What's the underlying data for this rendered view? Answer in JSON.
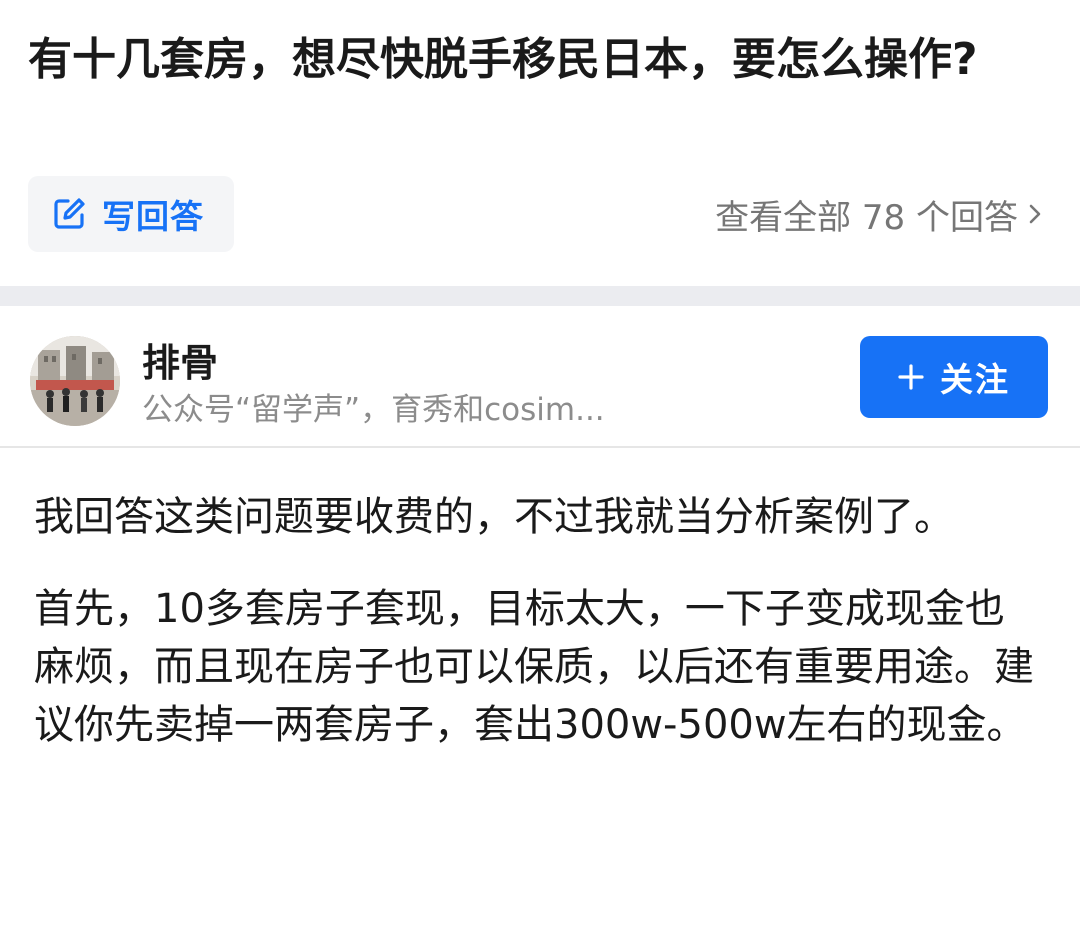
{
  "question": {
    "title": "有十几套房，想尽快脱手移民日本，要怎么操作?",
    "write_answer_label": "写回答",
    "view_all_label": "查看全部 78 个回答"
  },
  "answer": {
    "author": {
      "name": "排骨",
      "bio": "公众号“留学声”，育秀和cosim..."
    },
    "follow_label": "关注",
    "paragraphs": [
      "我回答这类问题要收费的，不过我就当分析案例了。",
      "首先，10多套房子套现，目标太大，一下子变成现金也麻烦，而且现在房子也可以保质，以后还有重要用途。建议你先卖掉一两套房子，套出300w-500w左右的现金。"
    ]
  },
  "colors": {
    "accent": "#1772f6",
    "secondary_text": "#767676",
    "divider": "#ebecf0"
  },
  "icons": {
    "write_answer": "edit-icon",
    "view_all": "chevron-right-icon",
    "follow": "plus-icon"
  }
}
